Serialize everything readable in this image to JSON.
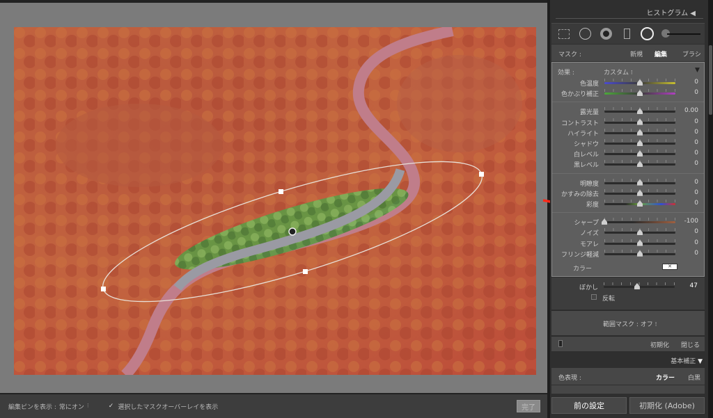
{
  "bottom_bar": {
    "pin_label": "編集ピンを表示 :",
    "pin_value": "常にオン",
    "overlay_label": "選択したマスクオーバーレイを表示",
    "overlay_checked": true,
    "done": "完了"
  },
  "panel": {
    "histogram_title": "ヒストグラム",
    "mask_label": "マスク :",
    "mask_new": "新規",
    "mask_edit": "編集",
    "mask_brush": "ブラシ",
    "effect_label": "効果 :",
    "effect_value": "カスタム",
    "sliders": [
      {
        "label": "色温度",
        "value": "0",
        "pos": 0.5,
        "track": "temp"
      },
      {
        "label": "色かぶり補正",
        "value": "0",
        "pos": 0.5,
        "track": "tint"
      },
      {
        "sep": true
      },
      {
        "label": "露光量",
        "value": "0.00",
        "pos": 0.5
      },
      {
        "label": "コントラスト",
        "value": "0",
        "pos": 0.5
      },
      {
        "label": "ハイライト",
        "value": "0",
        "pos": 0.5
      },
      {
        "label": "シャドウ",
        "value": "0",
        "pos": 0.5
      },
      {
        "label": "白レベル",
        "value": "0",
        "pos": 0.5
      },
      {
        "label": "黒レベル",
        "value": "0",
        "pos": 0.5
      },
      {
        "sep": true
      },
      {
        "label": "明瞭度",
        "value": "0",
        "pos": 0.5
      },
      {
        "label": "かすみの除去",
        "value": "0",
        "pos": 0.5
      },
      {
        "label": "彩度",
        "value": "0",
        "pos": 0.5,
        "track": "sat"
      },
      {
        "sep": true
      },
      {
        "label": "シャープ",
        "value": "-100",
        "pos": 0.0,
        "track": "sharp"
      },
      {
        "label": "ノイズ",
        "value": "0",
        "pos": 0.5
      },
      {
        "label": "モアレ",
        "value": "0",
        "pos": 0.5
      },
      {
        "label": "フリンジ軽減",
        "value": "0",
        "pos": 0.5
      }
    ],
    "color_label": "カラー",
    "feather_label": "ぼかし",
    "feather_value": "47",
    "feather_pos": 0.47,
    "invert_label": "反転",
    "invert_checked": false,
    "range_mask": "範囲マスク : オフ",
    "reset": "初期化",
    "close": "閉じる",
    "basic_title": "基本補正",
    "treatment_label": "色表現 :",
    "treatment_color": "カラー",
    "treatment_bw": "白黒",
    "prev_button": "前の設定",
    "reset_adobe_button": "初期化 (Adobe)"
  },
  "colors": {
    "overlay": "#c8553f",
    "annotation_arrow": "#ff2a1a",
    "accent_text": "#ffffff"
  }
}
